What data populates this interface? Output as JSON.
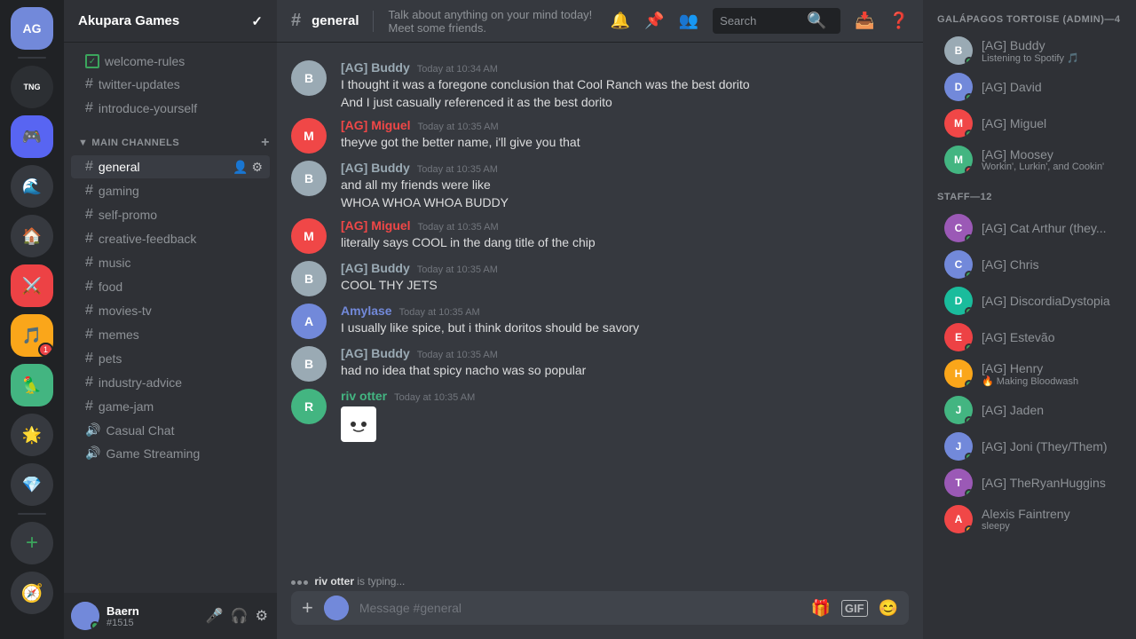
{
  "server_sidebar": {
    "servers": [
      {
        "id": "main",
        "initials": "AG",
        "color": "#7289da",
        "active": true
      },
      {
        "id": "tng",
        "initials": "TNG",
        "color": "#2c2f33"
      },
      {
        "id": "s3",
        "initials": "",
        "color": "#3ba55c"
      },
      {
        "id": "s4",
        "initials": "",
        "color": "#7289da"
      },
      {
        "id": "s5",
        "initials": "",
        "color": "#2c2f33"
      },
      {
        "id": "s6",
        "initials": "",
        "color": "#ed4245"
      },
      {
        "id": "s7",
        "initials": "",
        "color": "#faa61a",
        "badge": "1"
      },
      {
        "id": "s8",
        "initials": "",
        "color": "#43b581"
      },
      {
        "id": "s9",
        "initials": "",
        "color": "#9b59b6"
      },
      {
        "id": "s10",
        "initials": "",
        "color": "#1abc9c"
      }
    ],
    "add_server_label": "+",
    "discover_label": "🧭"
  },
  "channel_sidebar": {
    "server_name": "Akupara Games",
    "channels_top": [
      {
        "id": "welcome-rules",
        "name": "welcome-rules",
        "type": "check"
      }
    ],
    "categories": [
      {
        "name": "MAIN CHANNELS",
        "channels": [
          {
            "id": "general",
            "name": "general",
            "type": "text",
            "active": true
          },
          {
            "id": "gaming",
            "name": "gaming",
            "type": "text"
          },
          {
            "id": "self-promo",
            "name": "self-promo",
            "type": "text"
          },
          {
            "id": "creative-feedback",
            "name": "creative-feedback",
            "type": "text"
          },
          {
            "id": "music",
            "name": "music",
            "type": "text"
          },
          {
            "id": "food",
            "name": "food",
            "type": "text"
          },
          {
            "id": "movies-tv",
            "name": "movies-tv",
            "type": "text"
          },
          {
            "id": "memes",
            "name": "memes",
            "type": "text"
          },
          {
            "id": "pets",
            "name": "pets",
            "type": "text"
          },
          {
            "id": "industry-advice",
            "name": "industry-advice",
            "type": "text"
          },
          {
            "id": "game-jam",
            "name": "game-jam",
            "type": "text"
          }
        ]
      }
    ],
    "voice_channels": [
      {
        "id": "casual-chat",
        "name": "Casual Chat"
      },
      {
        "id": "game-streaming",
        "name": "Game Streaming"
      }
    ],
    "user": {
      "name": "Baern",
      "discriminator": "#1515",
      "avatar_color": "#7289da"
    }
  },
  "channel_header": {
    "name": "general",
    "topic": "Talk about anything on your mind today! Meet some friends.",
    "search_placeholder": "Search"
  },
  "messages": [
    {
      "id": "m1",
      "author": "[AG] Buddy",
      "author_class": "buddy",
      "timestamp": "Today at 10:34 AM",
      "lines": [
        "I thought it was a foregone conclusion that Cool Ranch was the best dorito",
        "And I just casually referenced it as the best dorito"
      ],
      "avatar_color": "#9aaab4"
    },
    {
      "id": "m2",
      "author": "[AG] Miguel",
      "author_class": "miguel",
      "timestamp": "Today at 10:35 AM",
      "lines": [
        "theyve got the better name, i'll give you that"
      ],
      "avatar_color": "#f04747"
    },
    {
      "id": "m3",
      "author": "[AG] Buddy",
      "author_class": "buddy",
      "timestamp": "Today at 10:35 AM",
      "lines": [
        "and all my friends were like",
        "WHOA WHOA WHOA BUDDY"
      ],
      "avatar_color": "#9aaab4"
    },
    {
      "id": "m4",
      "author": "[AG] Miguel",
      "author_class": "miguel",
      "timestamp": "Today at 10:35 AM",
      "lines": [
        "literally says COOL in the dang title of the chip"
      ],
      "avatar_color": "#f04747"
    },
    {
      "id": "m5",
      "author": "[AG] Buddy",
      "author_class": "buddy",
      "timestamp": "Today at 10:35 AM",
      "lines": [
        "COOL THY JETS"
      ],
      "avatar_color": "#9aaab4"
    },
    {
      "id": "m6",
      "author": "Amylase",
      "author_class": "amylase",
      "timestamp": "Today at 10:35 AM",
      "lines": [
        "I usually like spice, but i think doritos should be savory"
      ],
      "avatar_color": "#7289da"
    },
    {
      "id": "m7",
      "author": "[AG] Buddy",
      "author_class": "buddy",
      "timestamp": "Today at 10:35 AM",
      "lines": [
        "had no idea that spicy nacho was so popular"
      ],
      "avatar_color": "#9aaab4"
    },
    {
      "id": "m8",
      "author": "riv otter",
      "author_class": "rivotter",
      "timestamp": "Today at 10:35 AM",
      "lines": [],
      "has_emote": true,
      "avatar_color": "#43b581"
    }
  ],
  "input": {
    "placeholder": "Message #general"
  },
  "typing": {
    "text": " is typing..."
  },
  "typing_user": "riv otter",
  "members_sidebar": {
    "categories": [
      {
        "name": "GALÁPAGOS TORTOISE (ADMIN)—4",
        "members": [
          {
            "name": "[AG] Buddy",
            "activity": "Listening to Spotify 🎵",
            "status": "online",
            "color": "#9aaab4"
          },
          {
            "name": "[AG] David",
            "activity": "",
            "status": "online",
            "color": "#7289da"
          },
          {
            "name": "[AG] Miguel",
            "activity": "",
            "status": "online",
            "color": "#f04747"
          },
          {
            "name": "[AG] Moosey",
            "activity": "Workin', Lurkin', and Cookin'",
            "status": "dnd",
            "color": "#43b581"
          }
        ]
      },
      {
        "name": "STAFF—12",
        "members": [
          {
            "name": "[AG] Cat Arthur (they...",
            "activity": "",
            "status": "online",
            "color": "#9b59b6"
          },
          {
            "name": "[AG] Chris",
            "activity": "",
            "status": "online",
            "color": "#7289da"
          },
          {
            "name": "[AG] DiscordiaDystopia",
            "activity": "",
            "status": "online",
            "color": "#1abc9c"
          },
          {
            "name": "[AG] Estevão",
            "activity": "",
            "status": "online",
            "color": "#ed4245"
          },
          {
            "name": "[AG] Henry",
            "activity": "Making Bloodwash 🔥",
            "status": "online",
            "color": "#faa61a"
          },
          {
            "name": "[AG] Jaden",
            "activity": "",
            "status": "online",
            "color": "#43b581"
          },
          {
            "name": "[AG] Joni (They/Them)",
            "activity": "",
            "status": "online",
            "color": "#7289da"
          },
          {
            "name": "[AG] TheRyanHuggins",
            "activity": "",
            "status": "online",
            "color": "#9b59b6"
          },
          {
            "name": "Alexis Faintreny",
            "activity": "sleepy",
            "status": "idle",
            "color": "#f04747"
          }
        ]
      }
    ]
  }
}
